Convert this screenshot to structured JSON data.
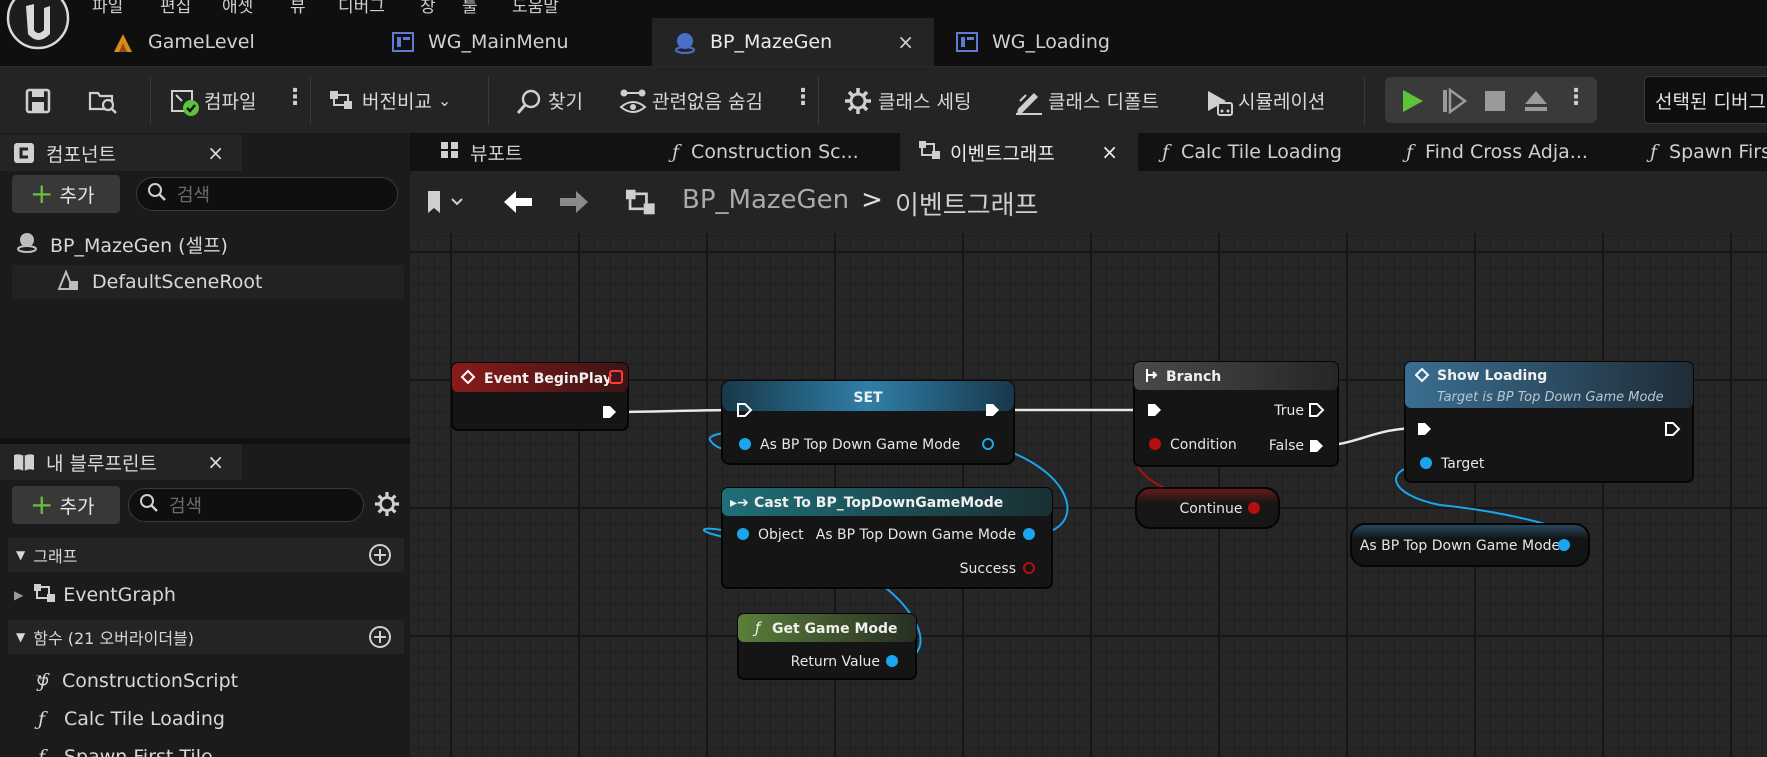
{
  "doc_tabs": [
    {
      "label": "GameLevel"
    },
    {
      "label": "WG_MainMenu"
    },
    {
      "label": "BP_MazeGen",
      "close": "×"
    },
    {
      "label": "WG_Loading"
    }
  ],
  "toolbar": {
    "compile": "컴파일",
    "diff": "버전비교",
    "find": "찾기",
    "hide_unrelated": "관련없음 숨김",
    "class_settings": "클래스 세팅",
    "class_defaults": "클래스 디폴트",
    "simulation": "시뮬레이션",
    "debug_select": "선택된 디버그"
  },
  "components_panel": {
    "title": "컴포넌트",
    "close": "×",
    "add": "추가",
    "search_placeholder": "검색",
    "items": [
      {
        "label": "BP_MazeGen (셀프)"
      },
      {
        "label": "DefaultSceneRoot"
      }
    ]
  },
  "blueprint_panel": {
    "title": "내 블루프린트",
    "close": "×",
    "add": "추가",
    "search_placeholder": "검색",
    "graph_section": "그래프",
    "graph_items": [
      {
        "label": "EventGraph"
      }
    ],
    "functions_section": "함수 (21 오버라이더블)",
    "function_items": [
      {
        "label": "ConstructionScript"
      },
      {
        "label": "Calc Tile Loading"
      },
      {
        "label": "Spawn First Tile"
      }
    ]
  },
  "graph_tabs": [
    {
      "label": "뷰포트"
    },
    {
      "label": "Construction Sc..."
    },
    {
      "label": "이벤트그래프",
      "close": "×"
    },
    {
      "label": "Calc Tile Loading"
    },
    {
      "label": "Find Cross Adja..."
    },
    {
      "label": "Spawn Firs"
    }
  ],
  "breadcrumb": {
    "root": "BP_MazeGen",
    "separator": ">",
    "current": "이벤트그래프"
  },
  "nodes": {
    "begin_play": {
      "title": "Event BeginPlay"
    },
    "set": {
      "title": "SET",
      "pin": "As BP Top Down Game Mode"
    },
    "cast": {
      "title": "Cast To BP_TopDownGameMode",
      "pin_object": "Object",
      "pin_out": "As BP Top Down Game Mode",
      "pin_success": "Success"
    },
    "get_game_mode": {
      "title": "Get Game Mode",
      "pin_return": "Return Value"
    },
    "branch": {
      "title": "Branch",
      "pin_true": "True",
      "pin_condition": "Condition",
      "pin_false": "False"
    },
    "continue": {
      "label": "Continue"
    },
    "show_loading": {
      "title": "Show Loading",
      "subtitle": "Target is BP Top Down Game Mode",
      "pin_target": "Target"
    },
    "var_get": {
      "label": "As BP Top Down Game Mode"
    }
  },
  "colors": {
    "event_header": "#8a1a1a",
    "set_header": "#2f7fa8",
    "cast_header": "#1f6f78",
    "pure_header": "#5b7f3a",
    "func_header": "#3a6f92",
    "object_pin": "#1aa6ef",
    "bool_pin": "#b40f0f",
    "play_green": "#5cc33a"
  }
}
